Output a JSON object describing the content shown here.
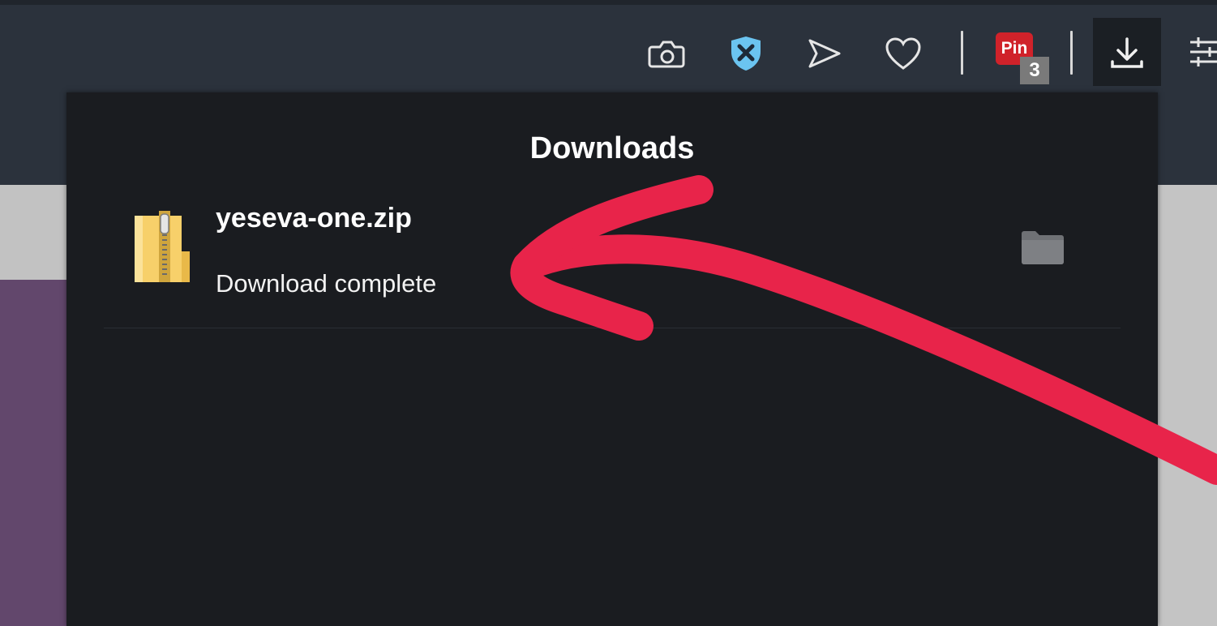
{
  "toolbar": {
    "icons": [
      "camera-icon",
      "shield-x-icon",
      "send-icon",
      "heart-icon",
      "pin-extension-icon",
      "download-icon",
      "settings-sliders-icon"
    ],
    "pin_label": "Pin",
    "pin_count": "3"
  },
  "downloads_panel": {
    "title": "Downloads",
    "items": [
      {
        "filename": "yeseva-one.zip",
        "status": "Download complete",
        "icon": "zip-folder-icon"
      }
    ]
  },
  "colors": {
    "toolbar_bg": "#2b323c",
    "panel_bg": "#1a1c20",
    "annotation_arrow": "#e8244a",
    "shield": "#6bc4f0",
    "pin_badge": "#d0222a"
  }
}
